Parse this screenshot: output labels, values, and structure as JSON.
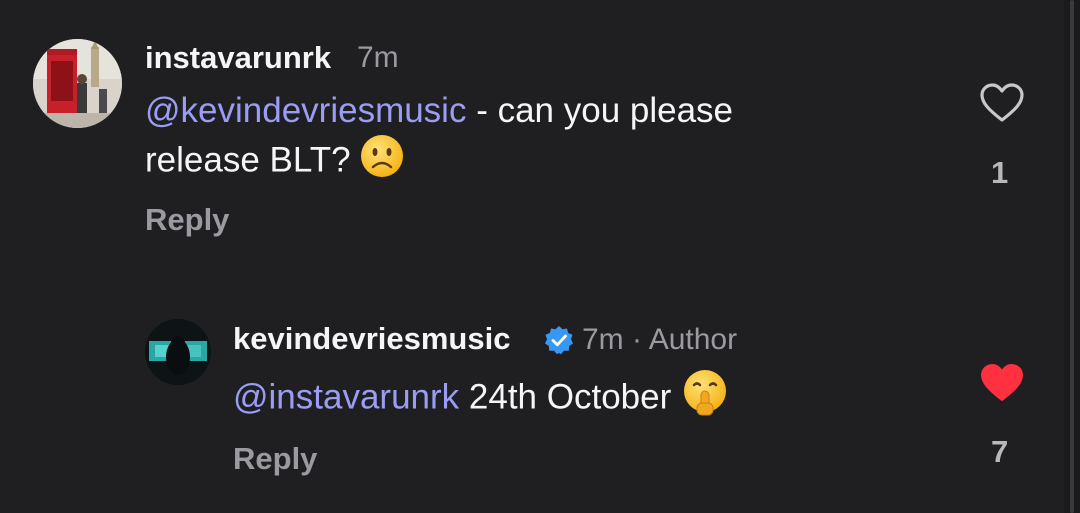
{
  "comment": {
    "username": "instavarunrk",
    "time": "7m",
    "mention": "@kevindevriesmusic",
    "text_line1": " - can you please",
    "text_line2": "release BLT?",
    "emoji_icon": "frowning-face-emoji",
    "reply_label": "Reply",
    "like_count": "1",
    "liked": false
  },
  "reply_comment": {
    "username": "kevindevriesmusic",
    "verified": true,
    "time": "7m",
    "separator": "·",
    "author_badge": "Author",
    "mention": "@instavarunrk",
    "text": " 24th October",
    "emoji_icon": "shushing-face-emoji",
    "reply_label": "Reply",
    "like_count": "7",
    "liked": true
  },
  "colors": {
    "background": "#1f1f22",
    "mention": "#9b9cf3",
    "muted": "#9a9aa0",
    "like_red": "#ff3040",
    "verified_blue": "#3897f0"
  }
}
